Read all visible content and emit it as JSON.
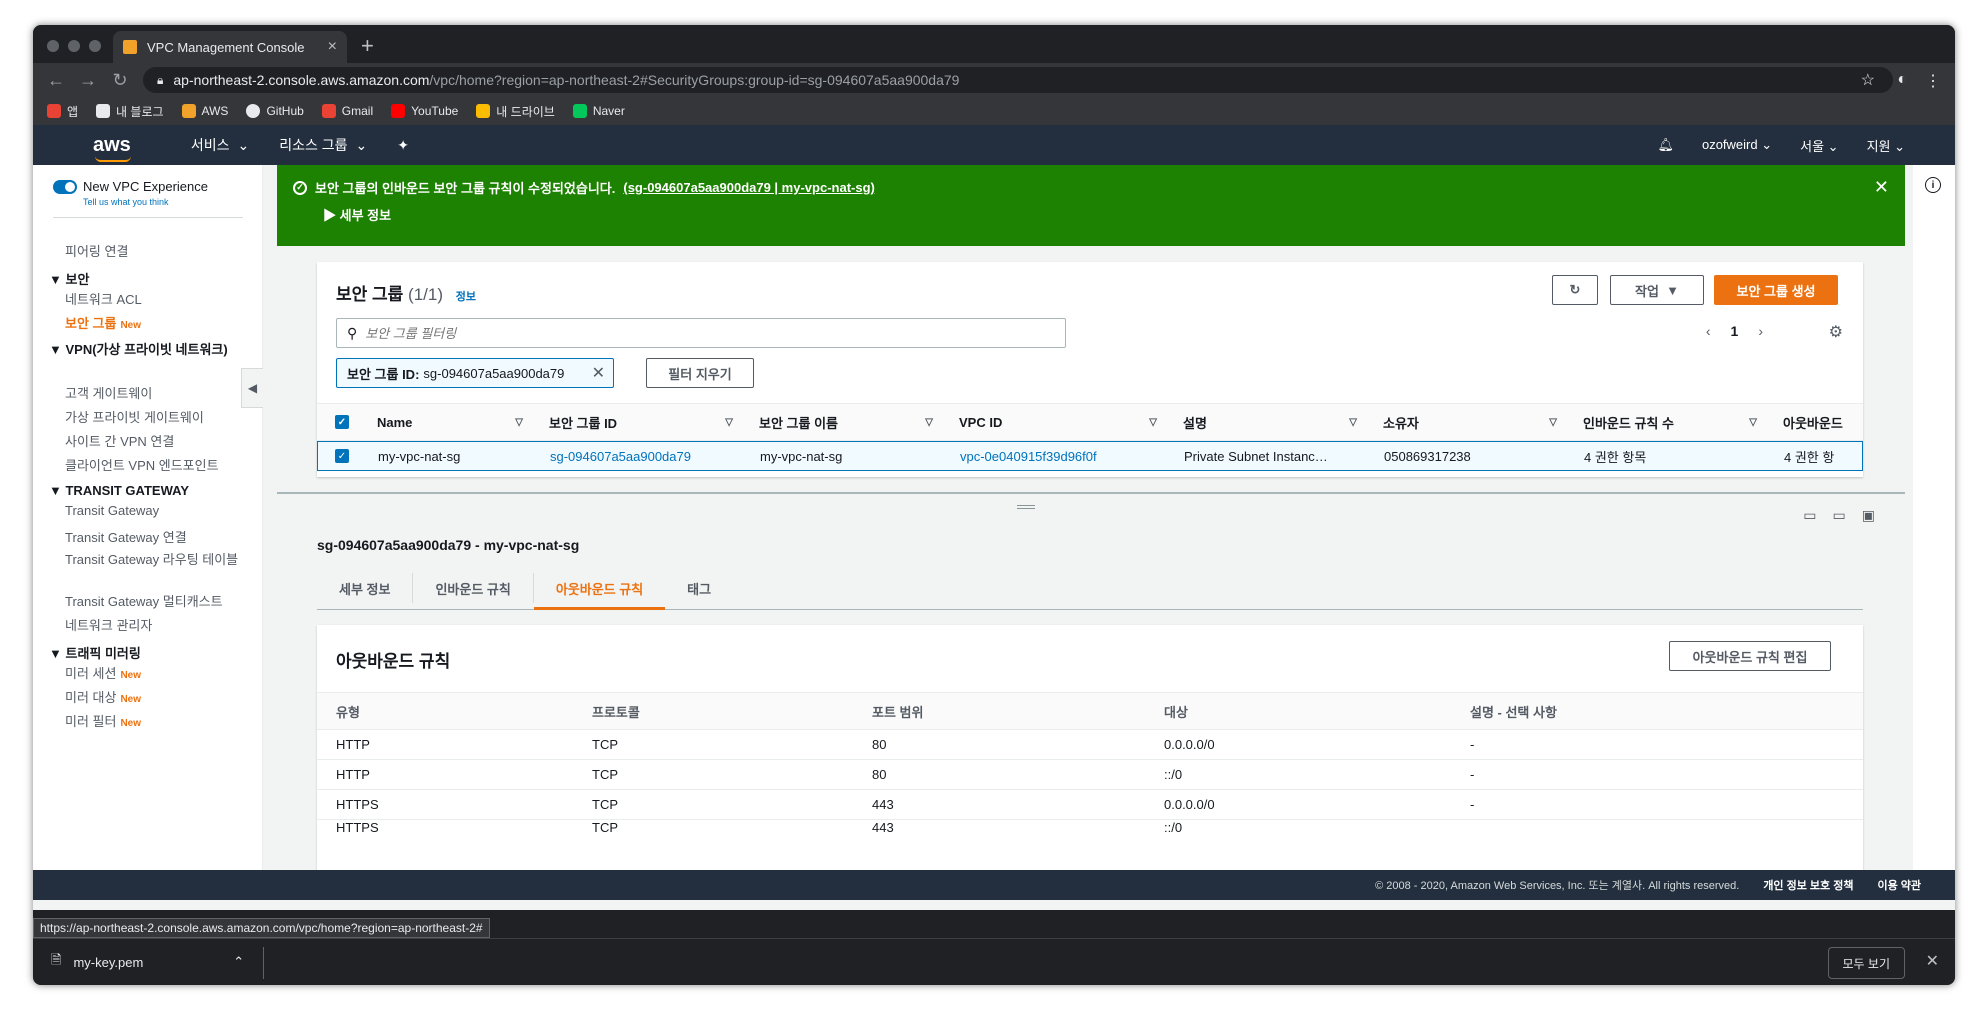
{
  "browser": {
    "tab_title": "VPC Management Console",
    "url_host": "ap-northeast-2.console.aws.amazon.com",
    "url_path": "/vpc/home?region=ap-northeast-2#SecurityGroups:group-id=sg-094607a5aa900da79",
    "status_url": "https://ap-northeast-2.console.aws.amazon.com/vpc/home?region=ap-northeast-2#",
    "bookmarks": [
      {
        "label": "앱",
        "color": "#ea4335"
      },
      {
        "label": "내 블로그",
        "color": "#e8eaed"
      },
      {
        "label": "AWS",
        "color": "#f0a22b"
      },
      {
        "label": "GitHub",
        "color": "#e8eaed"
      },
      {
        "label": "Gmail",
        "color": "#ea4335"
      },
      {
        "label": "YouTube",
        "color": "#ff0000"
      },
      {
        "label": "내 드라이브",
        "color": "#fbbc04"
      },
      {
        "label": "Naver",
        "color": "#03c75a"
      }
    ]
  },
  "aws_nav": {
    "logo": "aws",
    "services": "서비스",
    "resource_groups": "리소스 그룹",
    "user": "ozofweird",
    "region": "서울",
    "support": "지원"
  },
  "sidebar": {
    "toggle_label": "New VPC Experience",
    "toggle_sub": "Tell us what you think",
    "new_badge": "New",
    "items": {
      "peering": "피어링 연결",
      "security_head": "보안",
      "network_acl": "네트워크 ACL",
      "security_group": "보안 그룹",
      "vpn_head": "VPN(가상 프라이빗 네트워크)",
      "customer_gw": "고객 게이트웨이",
      "vpg": "가상 프라이빗 게이트웨이",
      "site_vpn": "사이트 간 VPN 연결",
      "client_vpn": "클라이언트 VPN 엔드포인트",
      "tgw_head": "TRANSIT GATEWAY",
      "tgw": "Transit Gateway",
      "tgw_attach": "Transit Gateway 연결",
      "tgw_route": "Transit Gateway 라우팅 테이블",
      "tgw_multicast": "Transit Gateway 멀티캐스트",
      "network_mgr": "네트워크 관리자",
      "mirror_head": "트래픽 미러링",
      "mirror_session": "미러 세션",
      "mirror_target": "미러 대상",
      "mirror_filter": "미러 필터"
    }
  },
  "flash": {
    "message": "보안 그룹의 인바운드 보안 그룹 규칙이 수정되었습니다.",
    "link": "(sg-094607a5aa900da79 | my-vpc-nat-sg)",
    "details": "세부 정보"
  },
  "sg_panel": {
    "title": "보안 그룹",
    "count": "(1/1)",
    "info": "정보",
    "actions": "작업",
    "create": "보안 그룹 생성",
    "search_placeholder": "보안 그룹 필터링",
    "page": "1",
    "token": "보안 그룹 ID: sg-094607a5aa900da79",
    "token_label": "보안 그룹 ID:",
    "token_value": "sg-094607a5aa900da79",
    "clear_filter": "필터 지우기",
    "columns": [
      "Name",
      "보안 그룹 ID",
      "보안 그룹 이름",
      "VPC ID",
      "설명",
      "소유자",
      "인바운드 규칙 수",
      "아웃바운드"
    ],
    "row": [
      "my-vpc-nat-sg",
      "sg-094607a5aa900da79",
      "my-vpc-nat-sg",
      "vpc-0e040915f39d96f0f",
      "Private Subnet Instanc…",
      "050869317238",
      "4 권한 항목",
      "4 권한 항"
    ]
  },
  "detail": {
    "title": "sg-094607a5aa900da79 - my-vpc-nat-sg",
    "tabs": [
      "세부 정보",
      "인바운드 규칙",
      "아웃바운드 규칙",
      "태그"
    ],
    "rules_title": "아웃바운드 규칙",
    "edit_button": "아웃바운드 규칙 편집",
    "columns": [
      "유형",
      "프로토콜",
      "포트 범위",
      "대상",
      "설명 - 선택 사항"
    ],
    "rows": [
      [
        "HTTP",
        "TCP",
        "80",
        "0.0.0.0/0",
        "-"
      ],
      [
        "HTTP",
        "TCP",
        "80",
        "::/0",
        "-"
      ],
      [
        "HTTPS",
        "TCP",
        "443",
        "0.0.0.0/0",
        "-"
      ],
      [
        "HTTPS",
        "TCP",
        "443",
        "::/0",
        ""
      ]
    ]
  },
  "footer": {
    "copyright": "© 2008 - 2020, Amazon Web Services, Inc. 또는 계열사. All rights reserved.",
    "privacy": "개인 정보 보호 정책",
    "terms": "이용 약관"
  },
  "downloads": {
    "file": "my-key.pem",
    "show_all": "모두 보기"
  }
}
